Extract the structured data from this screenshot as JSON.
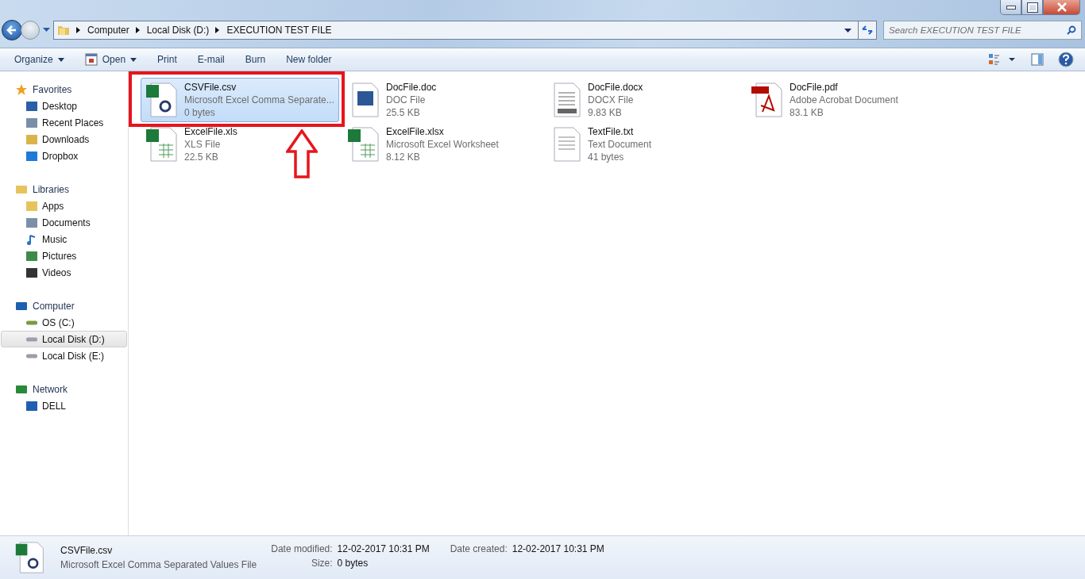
{
  "address": {
    "crumbs": [
      "Computer",
      "Local Disk (D:)",
      "EXECUTION TEST FILE"
    ]
  },
  "search": {
    "placeholder": "Search EXECUTION TEST FILE"
  },
  "toolbar": [
    {
      "label": "Organize",
      "kind": "menu"
    },
    {
      "label": "Open",
      "kind": "open"
    },
    {
      "label": "Print",
      "kind": "plain"
    },
    {
      "label": "E-mail",
      "kind": "plain"
    },
    {
      "label": "Burn",
      "kind": "plain"
    },
    {
      "label": "New folder",
      "kind": "plain"
    }
  ],
  "sidebar": [
    {
      "label": "Favorites",
      "kind": "star",
      "children": [
        {
          "label": "Desktop",
          "kind": "desktop",
          "selected": false
        },
        {
          "label": "Recent Places",
          "kind": "recent",
          "selected": false
        },
        {
          "label": "Downloads",
          "kind": "downloads",
          "selected": false
        },
        {
          "label": "Dropbox",
          "kind": "dropbox",
          "selected": false
        }
      ]
    },
    {
      "label": "Libraries",
      "kind": "library",
      "children": [
        {
          "label": "Apps",
          "kind": "folder",
          "selected": false
        },
        {
          "label": "Documents",
          "kind": "document",
          "selected": false
        },
        {
          "label": "Music",
          "kind": "music",
          "selected": false
        },
        {
          "label": "Pictures",
          "kind": "pictures",
          "selected": false
        },
        {
          "label": "Videos",
          "kind": "videos",
          "selected": false
        }
      ]
    },
    {
      "label": "Computer",
      "kind": "computer",
      "children": [
        {
          "label": "OS (C:)",
          "kind": "osdrive",
          "selected": false
        },
        {
          "label": "Local Disk (D:)",
          "kind": "drive",
          "selected": true
        },
        {
          "label": "Local Disk (E:)",
          "kind": "drive",
          "selected": false
        }
      ]
    },
    {
      "label": "Network",
      "kind": "network",
      "children": [
        {
          "label": "DELL",
          "kind": "computer",
          "selected": false
        }
      ]
    }
  ],
  "files": [
    {
      "name": "CSVFile.csv",
      "type": "Microsoft Excel Comma Separate...",
      "size": "0 bytes",
      "kind": "csv",
      "selected": true
    },
    {
      "name": "DocFile.doc",
      "type": "DOC File",
      "size": "25.5 KB",
      "kind": "doc",
      "selected": false
    },
    {
      "name": "DocFile.docx",
      "type": "DOCX File",
      "size": "9.83 KB",
      "kind": "docx",
      "selected": false
    },
    {
      "name": "DocFile.pdf",
      "type": "Adobe Acrobat Document",
      "size": "83.1 KB",
      "kind": "pdf",
      "selected": false
    },
    {
      "name": "ExcelFile.xls",
      "type": "XLS File",
      "size": "22.5 KB",
      "kind": "xls",
      "selected": false
    },
    {
      "name": "ExcelFile.xlsx",
      "type": "Microsoft Excel Worksheet",
      "size": "8.12 KB",
      "kind": "xlsx",
      "selected": false
    },
    {
      "name": "TextFile.txt",
      "type": "Text Document",
      "size": "41 bytes",
      "kind": "txt",
      "selected": false
    }
  ],
  "details": {
    "name": "CSVFile.csv",
    "type": "Microsoft Excel Comma Separated Values File",
    "kind": "csv",
    "fields": [
      {
        "label": "Date modified:",
        "value": "12-02-2017 10:31 PM"
      },
      {
        "label": "Size:",
        "value": "0 bytes"
      },
      {
        "label": "Date created:",
        "value": "12-02-2017 10:31 PM"
      }
    ]
  }
}
